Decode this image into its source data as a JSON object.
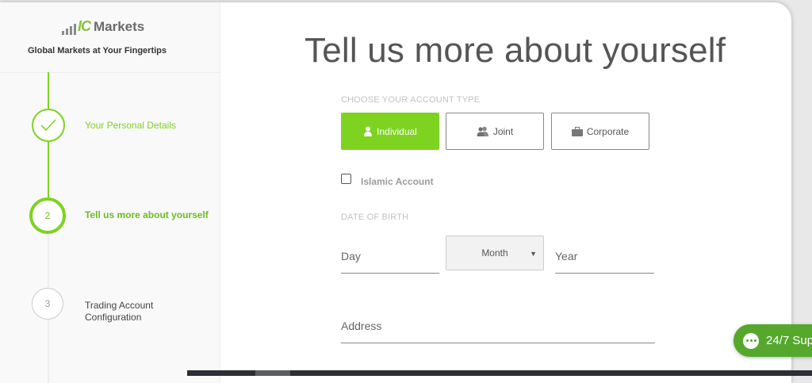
{
  "brand": {
    "logo_mark": "IC",
    "logo_name": "Markets",
    "tagline": "Global Markets at Your Fingertips"
  },
  "steps": [
    {
      "number": "",
      "label": "Your Personal Details",
      "status": "completed",
      "icon": "check-icon"
    },
    {
      "number": "2",
      "label": "Tell us more about yourself",
      "status": "current"
    },
    {
      "number": "3",
      "label": "Trading Account Configuration",
      "status": "pending"
    }
  ],
  "main": {
    "title": "Tell us more about yourself",
    "account_type_label": "CHOOSE YOUR ACCOUNT TYPE",
    "account_types": [
      {
        "label": "Individual",
        "selected": true,
        "icon": "person-icon"
      },
      {
        "label": "Joint",
        "selected": false,
        "icon": "people-icon"
      },
      {
        "label": "Corporate",
        "selected": false,
        "icon": "briefcase-icon"
      }
    ],
    "islamic_account": {
      "label": "Islamic Account",
      "checked": false
    },
    "dob_label": "DATE OF BIRTH",
    "day_placeholder": "Day",
    "month_value": "Month",
    "year_placeholder": "Year",
    "address_placeholder": "Address"
  },
  "support": {
    "label": "24/7 Sup",
    "icon": "chat-icon"
  },
  "colors": {
    "accent": "#7ed321",
    "support": "#56a82d"
  }
}
